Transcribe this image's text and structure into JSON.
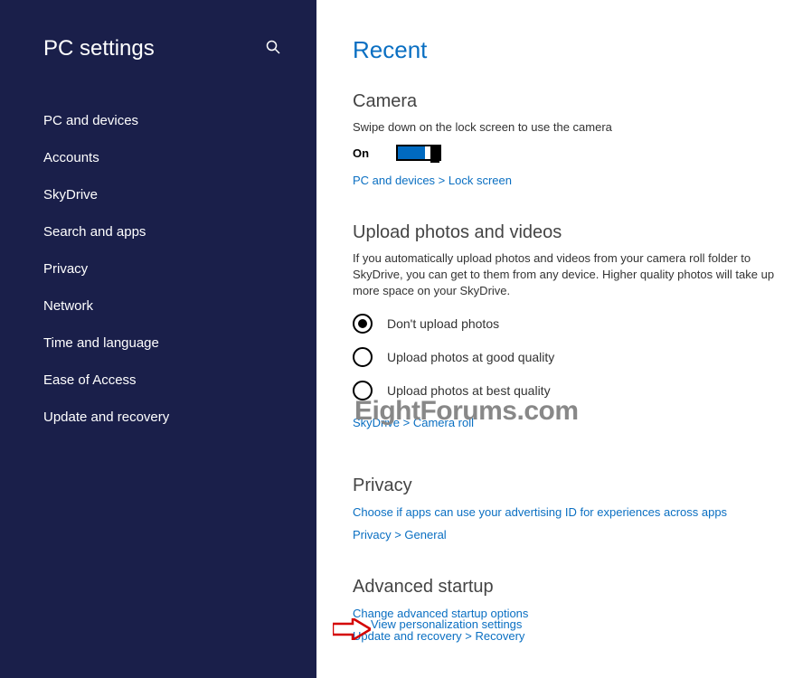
{
  "sidebar": {
    "title": "PC settings",
    "items": [
      {
        "label": "PC and devices"
      },
      {
        "label": "Accounts"
      },
      {
        "label": "SkyDrive"
      },
      {
        "label": "Search and apps"
      },
      {
        "label": "Privacy"
      },
      {
        "label": "Network"
      },
      {
        "label": "Time and language"
      },
      {
        "label": "Ease of Access"
      },
      {
        "label": "Update and recovery"
      }
    ]
  },
  "main": {
    "title": "Recent",
    "camera": {
      "heading": "Camera",
      "desc": "Swipe down on the lock screen to use the camera",
      "toggle_state": "On",
      "link": "PC and devices > Lock screen"
    },
    "upload": {
      "heading": "Upload photos and videos",
      "desc": "If you automatically upload photos and videos from your camera roll folder to SkyDrive, you can get to them from any device. Higher quality photos will take up more space on your SkyDrive.",
      "options": [
        {
          "label": "Don't upload photos",
          "checked": true
        },
        {
          "label": "Upload photos at good quality",
          "checked": false
        },
        {
          "label": "Upload photos at best quality",
          "checked": false
        }
      ],
      "link": "SkyDrive > Camera roll"
    },
    "privacy": {
      "heading": "Privacy",
      "link1": "Choose if apps can use your advertising ID for experiences across apps",
      "link2": "Privacy > General"
    },
    "startup": {
      "heading": "Advanced startup",
      "link1": "Change advanced startup options",
      "link2": "Update and recovery > Recovery"
    },
    "bottom_link": "View personalization settings"
  },
  "watermark": "EightForums.com"
}
